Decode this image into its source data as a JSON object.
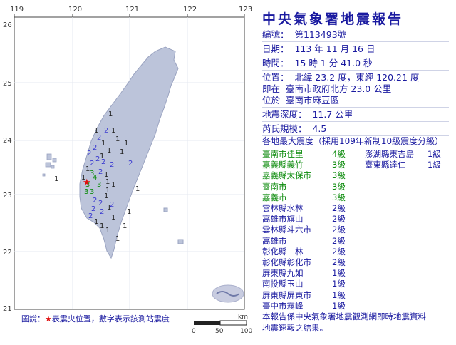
{
  "map": {
    "lon_labels": [
      "119",
      "120",
      "121",
      "122",
      "123"
    ],
    "lat_labels": [
      "26",
      "25",
      "24",
      "23",
      "22",
      "21"
    ],
    "legend_prefix": "圖說：",
    "legend_star": "★",
    "legend_text": "表震央位置，數字表示該測站震度",
    "scale_unit": "km",
    "scale_ticks": [
      "0",
      "50",
      "100"
    ],
    "station_intensities": [
      {
        "val": "1"
      },
      {
        "val": "2"
      },
      {
        "val": "1"
      },
      {
        "val": "1"
      },
      {
        "val": "2"
      },
      {
        "val": "1"
      },
      {
        "val": "1"
      },
      {
        "val": "2"
      },
      {
        "val": "2"
      },
      {
        "val": "1"
      },
      {
        "val": "1"
      },
      {
        "val": "1"
      },
      {
        "val": "2"
      },
      {
        "val": "2"
      },
      {
        "val": "2"
      },
      {
        "val": "2"
      },
      {
        "val": "1"
      },
      {
        "val": "3"
      },
      {
        "val": "2"
      },
      {
        "val": "1"
      },
      {
        "val": "1"
      },
      {
        "val": "3"
      },
      {
        "val": "3"
      },
      {
        "val": "1"
      },
      {
        "val": "4"
      },
      {
        "val": "3"
      },
      {
        "val": "1"
      },
      {
        "val": "1"
      },
      {
        "val": "3"
      },
      {
        "val": "2"
      },
      {
        "val": "1"
      },
      {
        "val": "2"
      },
      {
        "val": "1"
      },
      {
        "val": "2"
      },
      {
        "val": "2"
      },
      {
        "val": "1"
      },
      {
        "val": "2"
      },
      {
        "val": "1"
      },
      {
        "val": "1"
      },
      {
        "val": "1"
      },
      {
        "val": "1"
      },
      {
        "val": "1"
      },
      {
        "val": "1"
      },
      {
        "val": "1"
      },
      {
        "val": "1"
      },
      {
        "val": "2"
      },
      {
        "val": "2"
      },
      {
        "val": "1"
      }
    ],
    "colors": {
      "sea": "#ffffff",
      "land": "#bcc4da",
      "border": "#9aa3c0",
      "star": "#e01010",
      "text": "#1a1aa0"
    }
  },
  "report": {
    "title": "中央氣象署地震報告",
    "number": "編號：  第113493號",
    "date": "日期：  113 年 11 月 16 日",
    "time": "時間：  15 時 1 分 41.0 秒",
    "position": "位置：  北緯 23.2 度，東經 120.21 度",
    "at": "即在  臺南市政府北方 23.0 公里",
    "located": "位於  臺南市麻豆區",
    "depth": "地震深度：  11.7 公里",
    "magnitude": "芮氏規模：  4.5",
    "intensity_header": "各地最大震度（採用109年新制10級震度分級）",
    "intensities_left": [
      {
        "place": "臺南市佳里",
        "level": "4級"
      },
      {
        "place": "嘉義縣義竹",
        "level": "3級"
      },
      {
        "place": "嘉義縣太保市",
        "level": "3級"
      },
      {
        "place": "臺南市",
        "level": "3級"
      },
      {
        "place": "嘉義市",
        "level": "3級"
      },
      {
        "place": "雲林縣水林",
        "level": "2級"
      },
      {
        "place": "高雄市旗山",
        "level": "2級"
      },
      {
        "place": "雲林縣斗六市",
        "level": "2級"
      },
      {
        "place": "高雄市",
        "level": "2級"
      },
      {
        "place": "彰化縣二林",
        "level": "2級"
      },
      {
        "place": "彰化縣彰化市",
        "level": "2級"
      },
      {
        "place": "屏東縣九如",
        "level": "1級"
      },
      {
        "place": "南投縣玉山",
        "level": "1級"
      },
      {
        "place": "屏東縣屏東市",
        "level": "1級"
      },
      {
        "place": "臺中市霧峰",
        "level": "1級"
      }
    ],
    "intensities_right": [
      {
        "place": "澎湖縣東吉島",
        "level": "1級"
      },
      {
        "place": "臺東縣達仁",
        "level": "1級"
      }
    ],
    "footer_line1": "本報告係中央氣象署地震觀測網即時地震資料",
    "footer_line2": "地震速報之結果。"
  }
}
